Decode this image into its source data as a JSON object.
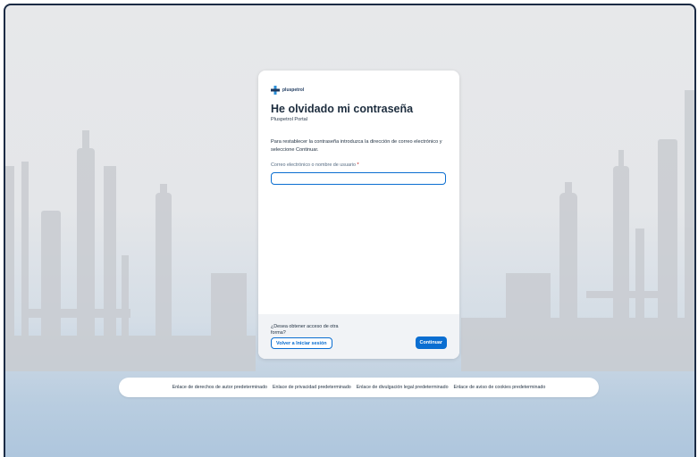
{
  "logo": {
    "text": "pluspetrol",
    "icon": "plus-cross-logo",
    "colors": [
      "#2a8fd8",
      "#1e3a5f"
    ]
  },
  "card": {
    "title": "He olvidado mi contraseña",
    "subtitle": "Pluspetrol Portal",
    "description": "Para restablecer la contraseña introduzca la dirección de correo electrónico y seleccione Continuar.",
    "field_label": "Correo electrónico o nombre de usuario",
    "required_mark": "*",
    "input_value": ""
  },
  "footer": {
    "question": "¿Desea obtener acceso de otra forma?",
    "back_button": "Volver a Iniciar sesión",
    "continue_button": "Continuar"
  },
  "links": [
    "Enlace de derechos de autor predeterminado",
    "Enlace de privacidad predeterminado",
    "Enlace de divulgación legal predeterminado",
    "Enlace de aviso de cookies predeterminado"
  ],
  "colors": {
    "accent": "#0a6ed1",
    "required": "#bb0000",
    "frame_border": "#1b2b45"
  }
}
